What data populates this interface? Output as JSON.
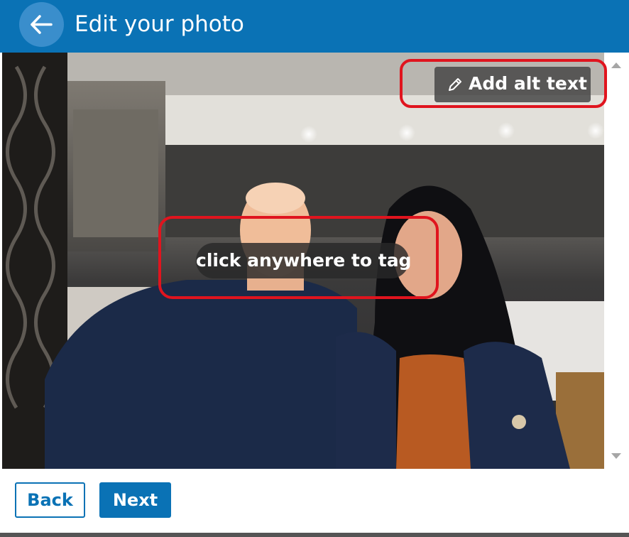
{
  "header": {
    "title": "Edit your photo",
    "back_icon": "arrow-left-icon",
    "color": "#0a72b5"
  },
  "photo": {
    "alt_text_button": {
      "label": "Add alt text",
      "icon": "pencil-icon"
    },
    "tag_hint": "click anywhere to tag",
    "highlight_color": "#e0141e"
  },
  "footer": {
    "back_label": "Back",
    "next_label": "Next"
  }
}
